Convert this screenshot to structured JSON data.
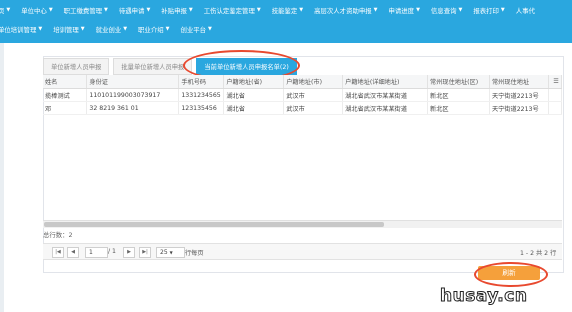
{
  "nav": {
    "row1": [
      "页",
      "单位中心",
      "职工缴费管理",
      "待遇申请",
      "补贴申报",
      "工伤认定鉴定管理",
      "技能鉴定",
      "高层次人才资助申报",
      "申请进度",
      "信息查询",
      "报表打印",
      "人事代"
    ],
    "row2": [
      "单位培训管理",
      "培训管理",
      "就业创业",
      "职业介绍",
      "创业平台"
    ]
  },
  "tabs": [
    "单位新增人员申报",
    "批量单位新增人员申报",
    "当前单位新增人员申报名单(2)"
  ],
  "table": {
    "columns": [
      "姓名",
      "身份证",
      "手机号码",
      "户籍地址(省)",
      "户籍地址(市)",
      "户籍地址(详细地址)",
      "常州现住地址(区)",
      "常州现住地址"
    ],
    "rows": [
      [
        "揽棒测试",
        "110101199003073917",
        "1331234565",
        "湖北省",
        "武汉市",
        "湖北省武汉市某某街道",
        "新北区",
        "天宁街道2213号"
      ],
      [
        "邓",
        "32   8219   361   01",
        "123135456",
        "湖北省",
        "武汉市",
        "湖北省武汉市某某街道",
        "新北区",
        "天宁街道2213号"
      ]
    ]
  },
  "total_label": "总行数：2",
  "pager": {
    "page": "1",
    "of": "/ 1",
    "page_size": "25",
    "per_page_label": "行每页",
    "range": "1 - 2 共 2 行"
  },
  "refresh_label": "刷新",
  "watermark": "husay.cn",
  "colors": {
    "accent": "#2aa7df",
    "refresh": "#f5a03b",
    "highlight": "#e8492f"
  }
}
